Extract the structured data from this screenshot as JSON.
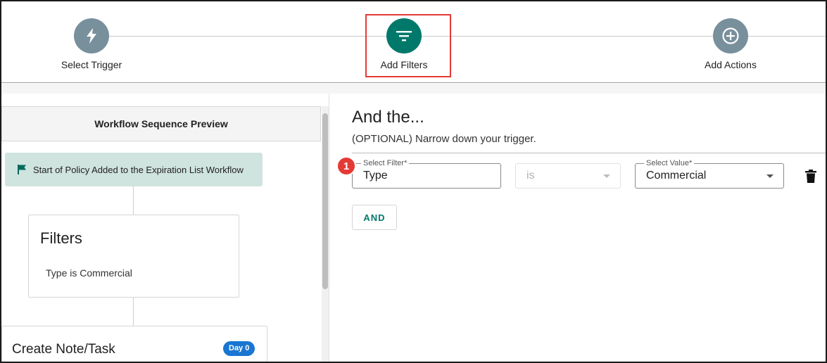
{
  "stepper": {
    "steps": [
      {
        "label": "Select Trigger",
        "icon": "lightning-bolt-icon",
        "color": "#78909c"
      },
      {
        "label": "Add Filters",
        "icon": "filter-icon",
        "color": "#00796b",
        "active": true
      },
      {
        "label": "Add Actions",
        "icon": "add-circle-icon",
        "color": "#78909c"
      }
    ]
  },
  "preview": {
    "header": "Workflow Sequence Preview",
    "start_label": "Start of Policy Added to the Expiration List Workflow",
    "filters_title": "Filters",
    "filters_desc": "Type is Commercial",
    "note_title": "Create Note/Task",
    "note_badge": "Day 0"
  },
  "filter_panel": {
    "heading": "And the...",
    "subheading": "(OPTIONAL) Narrow down your trigger.",
    "callout_number": "1",
    "select_filter": {
      "label": "Select Filter*",
      "value": "Type"
    },
    "operator": {
      "value": "is"
    },
    "select_value": {
      "label": "Select Value*",
      "value": "Commercial"
    },
    "and_button": "AND"
  },
  "colors": {
    "accent": "#00796b",
    "highlight": "#e53935",
    "badge_blue": "#1976d2",
    "start_card_bg": "#cfe3df"
  }
}
